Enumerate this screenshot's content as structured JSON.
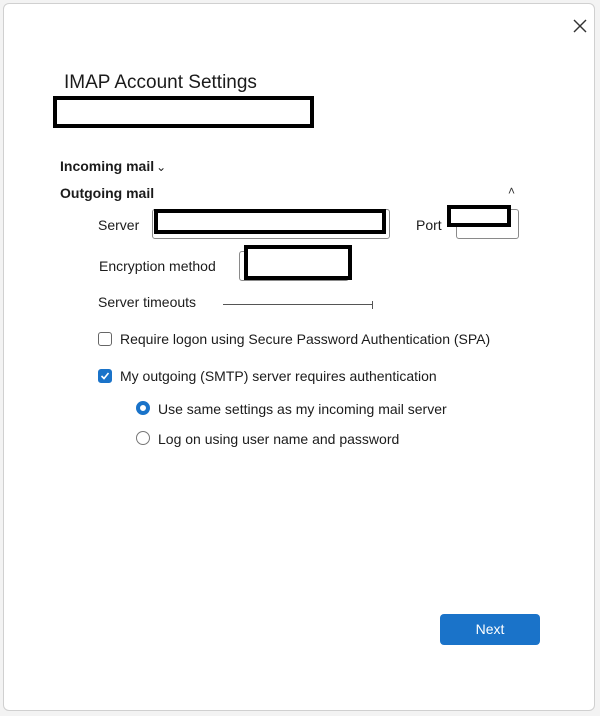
{
  "dialog": {
    "title": "IMAP Account Settings"
  },
  "sections": {
    "incoming_label": "Incoming mail",
    "incoming_chevron": "⌄",
    "outgoing_label": "Outgoing mail",
    "outgoing_chevron": "˄"
  },
  "outgoing": {
    "server_label": "Server",
    "server_value": "",
    "port_label": "Port",
    "port_value": "",
    "encryption_label": "Encryption method",
    "encryption_value": "",
    "timeouts_label": "Server timeouts",
    "spa_checkbox_label": "Require logon using Secure Password Authentication (SPA)",
    "spa_checked": false,
    "auth_checkbox_label": "My outgoing (SMTP) server requires authentication",
    "auth_checked": true,
    "radio_same_label": "Use same settings as my incoming mail server",
    "radio_logon_label": "Log on using user name and password",
    "selected_radio": "same"
  },
  "actions": {
    "next_label": "Next"
  },
  "colors": {
    "accent": "#1a73c9"
  }
}
